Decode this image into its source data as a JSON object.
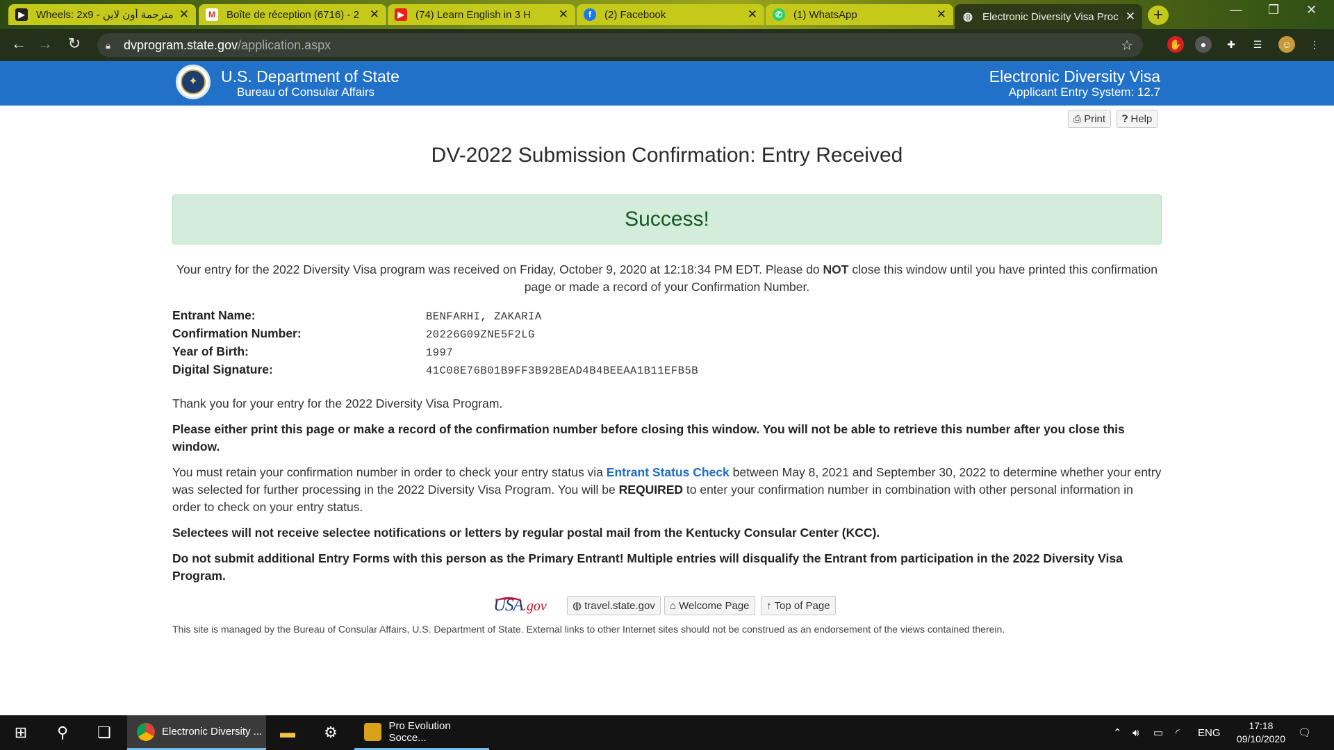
{
  "browser": {
    "tabs": [
      {
        "title": "Wheels: 2x9 - مترجمة أون لاين",
        "icon": "video-site-icon"
      },
      {
        "title": "Boîte de réception (6716) - 2",
        "icon": "gmail-icon"
      },
      {
        "title": "(74) Learn English in 3 H",
        "icon": "youtube-icon"
      },
      {
        "title": "(2) Facebook",
        "icon": "facebook-icon"
      },
      {
        "title": "(1) WhatsApp",
        "icon": "whatsapp-icon"
      },
      {
        "title": "Electronic Diversity Visa Proc",
        "icon": "globe-icon",
        "active": true
      }
    ],
    "url_host": "dvprogram.state.gov",
    "url_path": "/application.aspx"
  },
  "header": {
    "department": "U.S. Department of State",
    "bureau": "Bureau of Consular Affairs",
    "system_name": "Electronic Diversity Visa",
    "system_version": "Applicant Entry System: 12.7"
  },
  "toolbar": {
    "print_label": "Print",
    "help_label": "Help"
  },
  "main": {
    "title": "DV-2022 Submission Confirmation: Entry Received",
    "success": "Success!",
    "intro_before": "Your entry for the 2022 Diversity Visa program was received on Friday, October 9, 2020 at 12:18:34 PM EDT. Please do ",
    "intro_not": "NOT",
    "intro_after": " close this window until you have printed this confirmation page or made a record of your Confirmation Number.",
    "fields": {
      "entrant_name_label": "Entrant Name:",
      "entrant_name": "BENFARHI, ZAKARIA",
      "confirmation_label": "Confirmation Number:",
      "confirmation": "20226G09ZNE5F2LG",
      "yob_label": "Year of Birth:",
      "yob": "1997",
      "signature_label": "Digital Signature:",
      "signature": "41C08E76B01B9FF3B92BEAD4B4BEEAA1B11EFB5B"
    },
    "thanks": "Thank you for your entry for the 2022 Diversity Visa Program.",
    "print_warning": "Please either print this page or make a record of the confirmation number before closing this window. You will not be able to retrieve this number after you close this window.",
    "retain_1": "You must retain your confirmation number in order to check your entry status via ",
    "retain_link": "Entrant Status Check",
    "retain_2": " between May 8, 2021 and September 30, 2022 to determine whether your entry was selected for further processing in the 2022 Diversity Visa Program. You will be ",
    "retain_required": "REQUIRED",
    "retain_3": " to enter your confirmation number in combination with other personal information in order to check on your entry status.",
    "selectees_note": "Selectees will not receive selectee notifications or letters by regular postal mail from the Kentucky Consular Center (KCC).",
    "multiple_warning": "Do not submit additional Entry Forms with this person as the Primary Entrant! Multiple entries will disqualify the Entrant from participation in the 2022 Diversity Visa Program."
  },
  "footer": {
    "usagov_usa": "USA",
    "usagov_gov": ".gov",
    "travel_label": "travel.state.gov",
    "welcome_label": "Welcome Page",
    "top_label": "Top of Page",
    "disclaimer": "This site is managed by the Bureau of Consular Affairs, U.S. Department of State. External links to other Internet sites should not be construed as an endorsement of the views contained therein."
  },
  "taskbar": {
    "chrome_label": "Electronic Diversity ...",
    "pes_label": "Pro Evolution Socce...",
    "lang": "ENG",
    "time": "17:18",
    "date": "09/10/2020"
  },
  "colors": {
    "header_blue": "#2271c9",
    "success_bg": "#d4edda",
    "success_text": "#155724",
    "link": "#1f6cc4"
  }
}
